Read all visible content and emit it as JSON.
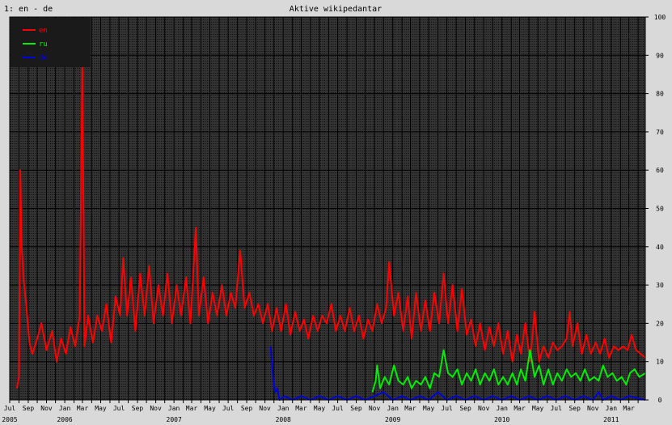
{
  "corner_label": "1: en - de",
  "chart_data": {
    "type": "line",
    "title": "Aktive wikipedantar",
    "xlabel": "",
    "ylabel": "",
    "x_range": [
      "2005-07-01",
      "2011-04-25"
    ],
    "ylim": [
      0,
      100
    ],
    "y_ticks": [
      0,
      10,
      20,
      30,
      40,
      50,
      60,
      70,
      80,
      90,
      100
    ],
    "grid": true,
    "legend_position": "top-left",
    "month_ticks": [
      "Jul",
      "Sep",
      "Nov",
      "Jan",
      "Mar",
      "May",
      "Jul",
      "Sep",
      "Nov",
      "Jan",
      "Mar",
      "May",
      "Jul",
      "Sep",
      "Nov",
      "Jan",
      "Mar",
      "May",
      "Jul",
      "Sep",
      "Nov",
      "Jan",
      "Mar",
      "May",
      "Jul",
      "Sep",
      "Nov",
      "Jan",
      "Mar",
      "May",
      "Jul",
      "Sep",
      "Nov",
      "Jan",
      "Mar"
    ],
    "month_dates": [
      "2005-07",
      "2005-09",
      "2005-11",
      "2006-01",
      "2006-03",
      "2006-05",
      "2006-07",
      "2006-09",
      "2006-11",
      "2007-01",
      "2007-03",
      "2007-05",
      "2007-07",
      "2007-09",
      "2007-11",
      "2008-01",
      "2008-03",
      "2008-05",
      "2008-07",
      "2008-09",
      "2008-11",
      "2009-01",
      "2009-03",
      "2009-05",
      "2009-07",
      "2009-09",
      "2009-11",
      "2010-01",
      "2010-03",
      "2010-05",
      "2010-07",
      "2010-09",
      "2010-11",
      "2011-01",
      "2011-03"
    ],
    "year_ticks": [
      {
        "label": "2005",
        "date": "2005-07"
      },
      {
        "label": "2006",
        "date": "2006-01"
      },
      {
        "label": "2007",
        "date": "2007-01"
      },
      {
        "label": "2008",
        "date": "2008-01"
      },
      {
        "label": "2009",
        "date": "2009-01"
      },
      {
        "label": "2010",
        "date": "2010-01"
      },
      {
        "label": "2011",
        "date": "2011-01"
      }
    ],
    "series": [
      {
        "name": "en",
        "color": "#ff0000",
        "points": [
          [
            "2005-07-25",
            3
          ],
          [
            "2005-08-01",
            6
          ],
          [
            "2005-08-05",
            60
          ],
          [
            "2005-08-10",
            40
          ],
          [
            "2005-08-18",
            30
          ],
          [
            "2005-08-25",
            25
          ],
          [
            "2005-09-05",
            15
          ],
          [
            "2005-09-15",
            12
          ],
          [
            "2005-10-01",
            16
          ],
          [
            "2005-10-15",
            20
          ],
          [
            "2005-11-01",
            13
          ],
          [
            "2005-11-20",
            18
          ],
          [
            "2005-12-05",
            10
          ],
          [
            "2005-12-20",
            16
          ],
          [
            "2006-01-05",
            12
          ],
          [
            "2006-01-20",
            19
          ],
          [
            "2006-02-05",
            14
          ],
          [
            "2006-02-20",
            22
          ],
          [
            "2006-03-01",
            88
          ],
          [
            "2006-03-08",
            14
          ],
          [
            "2006-03-20",
            22
          ],
          [
            "2006-04-05",
            15
          ],
          [
            "2006-04-20",
            22
          ],
          [
            "2006-05-05",
            18
          ],
          [
            "2006-05-20",
            25
          ],
          [
            "2006-06-05",
            15
          ],
          [
            "2006-06-20",
            27
          ],
          [
            "2006-07-05",
            22
          ],
          [
            "2006-07-15",
            37
          ],
          [
            "2006-07-28",
            22
          ],
          [
            "2006-08-10",
            32
          ],
          [
            "2006-08-25",
            18
          ],
          [
            "2006-09-10",
            33
          ],
          [
            "2006-09-25",
            22
          ],
          [
            "2006-10-10",
            35
          ],
          [
            "2006-10-25",
            20
          ],
          [
            "2006-11-10",
            30
          ],
          [
            "2006-11-25",
            22
          ],
          [
            "2006-12-10",
            33
          ],
          [
            "2006-12-25",
            20
          ],
          [
            "2007-01-10",
            30
          ],
          [
            "2007-01-25",
            22
          ],
          [
            "2007-02-10",
            32
          ],
          [
            "2007-02-25",
            20
          ],
          [
            "2007-03-15",
            45
          ],
          [
            "2007-03-25",
            22
          ],
          [
            "2007-04-10",
            32
          ],
          [
            "2007-04-25",
            20
          ],
          [
            "2007-05-10",
            28
          ],
          [
            "2007-05-25",
            22
          ],
          [
            "2007-06-10",
            30
          ],
          [
            "2007-06-25",
            22
          ],
          [
            "2007-07-10",
            28
          ],
          [
            "2007-07-25",
            24
          ],
          [
            "2007-08-10",
            39
          ],
          [
            "2007-08-25",
            24
          ],
          [
            "2007-09-10",
            28
          ],
          [
            "2007-09-25",
            22
          ],
          [
            "2007-10-10",
            25
          ],
          [
            "2007-10-25",
            20
          ],
          [
            "2007-11-10",
            25
          ],
          [
            "2007-11-25",
            18
          ],
          [
            "2007-12-10",
            24
          ],
          [
            "2007-12-25",
            18
          ],
          [
            "2008-01-10",
            25
          ],
          [
            "2008-01-25",
            17
          ],
          [
            "2008-02-10",
            23
          ],
          [
            "2008-02-25",
            18
          ],
          [
            "2008-03-10",
            21
          ],
          [
            "2008-03-25",
            16
          ],
          [
            "2008-04-10",
            22
          ],
          [
            "2008-04-25",
            18
          ],
          [
            "2008-05-10",
            22
          ],
          [
            "2008-05-25",
            20
          ],
          [
            "2008-06-10",
            25
          ],
          [
            "2008-06-25",
            18
          ],
          [
            "2008-07-10",
            22
          ],
          [
            "2008-07-25",
            18
          ],
          [
            "2008-08-10",
            24
          ],
          [
            "2008-08-25",
            18
          ],
          [
            "2008-09-10",
            22
          ],
          [
            "2008-09-25",
            16
          ],
          [
            "2008-10-10",
            21
          ],
          [
            "2008-10-25",
            18
          ],
          [
            "2008-11-10",
            25
          ],
          [
            "2008-11-25",
            20
          ],
          [
            "2008-12-10",
            24
          ],
          [
            "2008-12-20",
            36
          ],
          [
            "2009-01-05",
            22
          ],
          [
            "2009-01-20",
            28
          ],
          [
            "2009-02-05",
            18
          ],
          [
            "2009-02-20",
            27
          ],
          [
            "2009-03-05",
            16
          ],
          [
            "2009-03-20",
            28
          ],
          [
            "2009-04-05",
            18
          ],
          [
            "2009-04-20",
            26
          ],
          [
            "2009-05-05",
            18
          ],
          [
            "2009-05-20",
            28
          ],
          [
            "2009-06-05",
            20
          ],
          [
            "2009-06-20",
            33
          ],
          [
            "2009-07-05",
            20
          ],
          [
            "2009-07-20",
            30
          ],
          [
            "2009-08-05",
            18
          ],
          [
            "2009-08-20",
            29
          ],
          [
            "2009-09-05",
            17
          ],
          [
            "2009-09-20",
            21
          ],
          [
            "2009-10-05",
            14
          ],
          [
            "2009-10-20",
            20
          ],
          [
            "2009-11-05",
            13
          ],
          [
            "2009-11-20",
            19
          ],
          [
            "2009-12-05",
            14
          ],
          [
            "2009-12-20",
            20
          ],
          [
            "2010-01-05",
            12
          ],
          [
            "2010-01-20",
            18
          ],
          [
            "2010-02-05",
            10
          ],
          [
            "2010-02-20",
            17
          ],
          [
            "2010-03-05",
            12
          ],
          [
            "2010-03-20",
            20
          ],
          [
            "2010-04-05",
            10
          ],
          [
            "2010-04-20",
            23
          ],
          [
            "2010-05-05",
            10
          ],
          [
            "2010-05-20",
            14
          ],
          [
            "2010-06-05",
            11
          ],
          [
            "2010-06-20",
            15
          ],
          [
            "2010-07-05",
            13
          ],
          [
            "2010-07-20",
            14
          ],
          [
            "2010-08-05",
            16
          ],
          [
            "2010-08-15",
            23
          ],
          [
            "2010-08-25",
            14
          ],
          [
            "2010-09-10",
            20
          ],
          [
            "2010-09-25",
            12
          ],
          [
            "2010-10-10",
            17
          ],
          [
            "2010-10-25",
            12
          ],
          [
            "2010-11-10",
            15
          ],
          [
            "2010-11-25",
            12
          ],
          [
            "2010-12-10",
            16
          ],
          [
            "2010-12-25",
            11
          ],
          [
            "2011-01-10",
            14
          ],
          [
            "2011-01-25",
            13
          ],
          [
            "2011-02-10",
            14
          ],
          [
            "2011-02-25",
            13
          ],
          [
            "2011-03-10",
            17
          ],
          [
            "2011-03-25",
            13
          ],
          [
            "2011-04-10",
            12
          ],
          [
            "2011-04-25",
            11
          ]
        ]
      },
      {
        "name": "ru",
        "color": "#00ee00",
        "points": [
          [
            "2008-10-25",
            2
          ],
          [
            "2008-11-05",
            5
          ],
          [
            "2008-11-10",
            9
          ],
          [
            "2008-11-20",
            3
          ],
          [
            "2008-12-05",
            6
          ],
          [
            "2008-12-20",
            4
          ],
          [
            "2009-01-05",
            9
          ],
          [
            "2009-01-20",
            5
          ],
          [
            "2009-02-05",
            4
          ],
          [
            "2009-02-20",
            6
          ],
          [
            "2009-03-05",
            3
          ],
          [
            "2009-03-20",
            5
          ],
          [
            "2009-04-05",
            4
          ],
          [
            "2009-04-20",
            6
          ],
          [
            "2009-05-05",
            3
          ],
          [
            "2009-05-20",
            7
          ],
          [
            "2009-06-05",
            6
          ],
          [
            "2009-06-20",
            13
          ],
          [
            "2009-07-05",
            7
          ],
          [
            "2009-07-20",
            6
          ],
          [
            "2009-08-05",
            8
          ],
          [
            "2009-08-20",
            4
          ],
          [
            "2009-09-05",
            7
          ],
          [
            "2009-09-20",
            5
          ],
          [
            "2009-10-05",
            8
          ],
          [
            "2009-10-20",
            4
          ],
          [
            "2009-11-05",
            7
          ],
          [
            "2009-11-20",
            5
          ],
          [
            "2009-12-05",
            8
          ],
          [
            "2009-12-20",
            4
          ],
          [
            "2010-01-05",
            6
          ],
          [
            "2010-01-20",
            4
          ],
          [
            "2010-02-05",
            7
          ],
          [
            "2010-02-20",
            4
          ],
          [
            "2010-03-05",
            8
          ],
          [
            "2010-03-20",
            5
          ],
          [
            "2010-04-05",
            13
          ],
          [
            "2010-04-20",
            6
          ],
          [
            "2010-05-05",
            9
          ],
          [
            "2010-05-20",
            4
          ],
          [
            "2010-06-05",
            8
          ],
          [
            "2010-06-20",
            4
          ],
          [
            "2010-07-05",
            7
          ],
          [
            "2010-07-20",
            5
          ],
          [
            "2010-08-05",
            8
          ],
          [
            "2010-08-20",
            6
          ],
          [
            "2010-09-05",
            7
          ],
          [
            "2010-09-20",
            5
          ],
          [
            "2010-10-05",
            8
          ],
          [
            "2010-10-20",
            5
          ],
          [
            "2010-11-05",
            6
          ],
          [
            "2010-11-20",
            5
          ],
          [
            "2010-12-05",
            9
          ],
          [
            "2010-12-20",
            6
          ],
          [
            "2011-01-05",
            7
          ],
          [
            "2011-01-20",
            5
          ],
          [
            "2011-02-05",
            6
          ],
          [
            "2011-02-20",
            4
          ],
          [
            "2011-03-05",
            7
          ],
          [
            "2011-03-20",
            8
          ],
          [
            "2011-04-05",
            6
          ],
          [
            "2011-04-25",
            7
          ]
        ]
      },
      {
        "name": "de",
        "color": "#0000dd",
        "points": [
          [
            "2007-11-20",
            14
          ],
          [
            "2007-11-28",
            6
          ],
          [
            "2007-12-05",
            2
          ],
          [
            "2007-12-12",
            3
          ],
          [
            "2007-12-20",
            0
          ],
          [
            "2008-01-05",
            1
          ],
          [
            "2008-02-01",
            0
          ],
          [
            "2008-03-01",
            1
          ],
          [
            "2008-04-01",
            0
          ],
          [
            "2008-05-01",
            1
          ],
          [
            "2008-06-01",
            0
          ],
          [
            "2008-07-01",
            1
          ],
          [
            "2008-08-01",
            0
          ],
          [
            "2008-09-01",
            1
          ],
          [
            "2008-10-01",
            0
          ],
          [
            "2008-11-01",
            1
          ],
          [
            "2008-12-01",
            2
          ],
          [
            "2009-01-01",
            0
          ],
          [
            "2009-02-01",
            1
          ],
          [
            "2009-03-01",
            0
          ],
          [
            "2009-04-01",
            1
          ],
          [
            "2009-05-01",
            0
          ],
          [
            "2009-06-01",
            2
          ],
          [
            "2009-07-01",
            0
          ],
          [
            "2009-08-01",
            1
          ],
          [
            "2009-09-01",
            0
          ],
          [
            "2009-10-01",
            1
          ],
          [
            "2009-11-01",
            0
          ],
          [
            "2009-12-01",
            1
          ],
          [
            "2010-01-01",
            0
          ],
          [
            "2010-02-01",
            1
          ],
          [
            "2010-03-01",
            0
          ],
          [
            "2010-04-01",
            1
          ],
          [
            "2010-05-01",
            0
          ],
          [
            "2010-06-01",
            1
          ],
          [
            "2010-07-01",
            0
          ],
          [
            "2010-08-01",
            1
          ],
          [
            "2010-09-01",
            0
          ],
          [
            "2010-10-01",
            1
          ],
          [
            "2010-11-01",
            0
          ],
          [
            "2010-11-20",
            2
          ],
          [
            "2010-12-05",
            0
          ],
          [
            "2011-01-01",
            1
          ],
          [
            "2011-02-01",
            0
          ],
          [
            "2011-03-01",
            1
          ],
          [
            "2011-04-25",
            0
          ]
        ]
      }
    ]
  }
}
